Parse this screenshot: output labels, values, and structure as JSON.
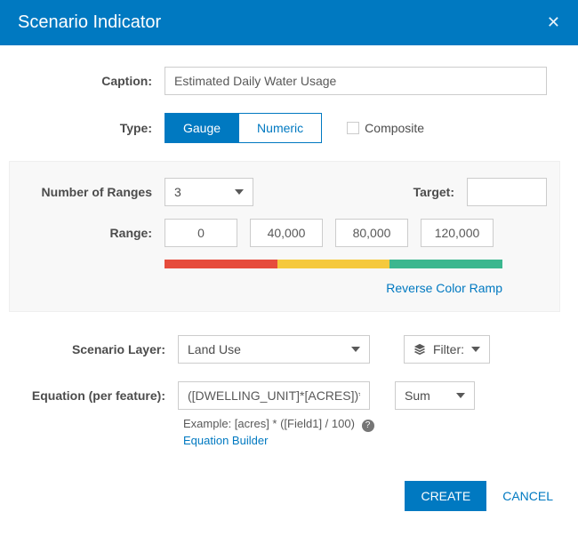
{
  "header": {
    "title": "Scenario Indicator"
  },
  "caption": {
    "label": "Caption:",
    "value": "Estimated Daily Water Usage"
  },
  "type": {
    "label": "Type:",
    "options": [
      "Gauge",
      "Numeric"
    ],
    "selected": "Gauge",
    "composite_label": "Composite",
    "composite_checked": false
  },
  "ranges": {
    "count_label": "Number of Ranges",
    "count_value": "3",
    "target_label": "Target:",
    "target_value": "",
    "range_label": "Range:",
    "values": [
      "0",
      "40,000",
      "80,000",
      "120,000"
    ],
    "reverse_label": "Reverse Color Ramp",
    "ramp_colors": [
      "#e64c3c",
      "#f5c93d",
      "#3bb78f"
    ]
  },
  "scenario_layer": {
    "label": "Scenario Layer:",
    "value": "Land Use",
    "filter_label": "Filter:"
  },
  "equation": {
    "label": "Equation (per feature):",
    "value": "([DWELLING_UNIT]*[ACRES])*[WATE",
    "agg": "Sum",
    "example_label": "Example: [acres] * ([Field1] / 100)",
    "builder_label": "Equation Builder"
  },
  "footer": {
    "create": "CREATE",
    "cancel": "CANCEL"
  }
}
